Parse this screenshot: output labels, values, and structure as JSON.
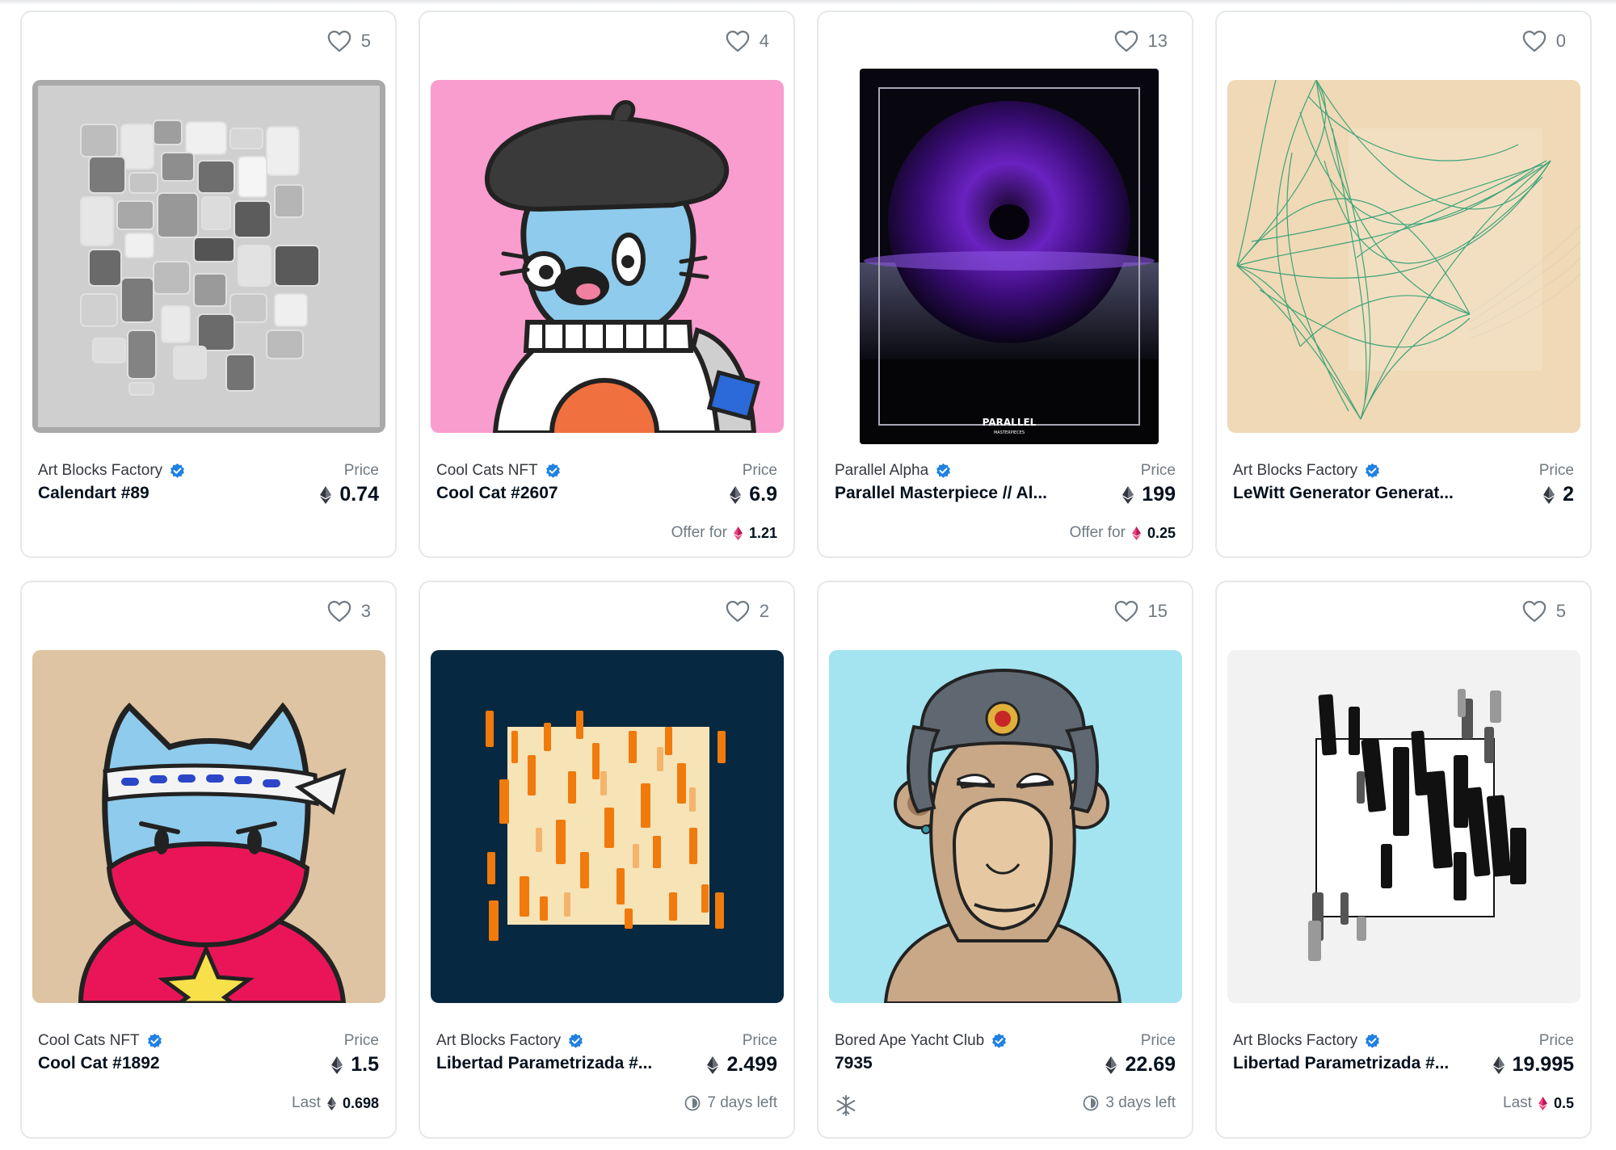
{
  "colors": {
    "eth": "#353840",
    "weth": "#ec407a",
    "verified": "#2081e2",
    "border": "#e5e8eb",
    "muted": "#707a83"
  },
  "price_label": "Price",
  "cards": [
    {
      "favorites": "5",
      "collection": "Art Blocks Factory",
      "name": "Calendart #89",
      "price": "0.74"
    },
    {
      "favorites": "4",
      "collection": "Cool Cats NFT",
      "name": "Cool Cat #2607",
      "price": "6.9",
      "sub_label": "Offer for",
      "sub_value": "1.21",
      "sub_icon": "weth-icon"
    },
    {
      "favorites": "13",
      "collection": "Parallel Alpha",
      "name": "Parallel Masterpiece // Al...",
      "price": "199",
      "sub_label": "Offer for",
      "sub_value": "0.25",
      "sub_icon": "weth-icon",
      "artwork_caption": "PARALLEL",
      "artwork_subcaption": "MASTERPIECES"
    },
    {
      "favorites": "0",
      "collection": "Art Blocks Factory",
      "name": "LeWitt Generator Generat...",
      "price": "2"
    },
    {
      "favorites": "3",
      "collection": "Cool Cats NFT",
      "name": "Cool Cat #1892",
      "price": "1.5",
      "sub_label": "Last",
      "sub_value": "0.698",
      "sub_icon": "eth-icon"
    },
    {
      "favorites": "2",
      "collection": "Art Blocks Factory",
      "name": "Libertad Parametrizada #...",
      "price": "2.499",
      "sub_value": "7 days left",
      "sub_icon": "clock-icon"
    },
    {
      "favorites": "15",
      "collection": "Bored Ape Yacht Club",
      "name": "7935",
      "price": "22.69",
      "sub_value": "3 days left",
      "sub_icon": "clock-icon",
      "frozen_icon": "snowflake-icon"
    },
    {
      "favorites": "5",
      "collection": "Art Blocks Factory",
      "name": "Libertad Parametrizada #...",
      "price": "19.995",
      "sub_label": "Last",
      "sub_value": "0.5",
      "sub_icon": "weth-icon"
    }
  ]
}
